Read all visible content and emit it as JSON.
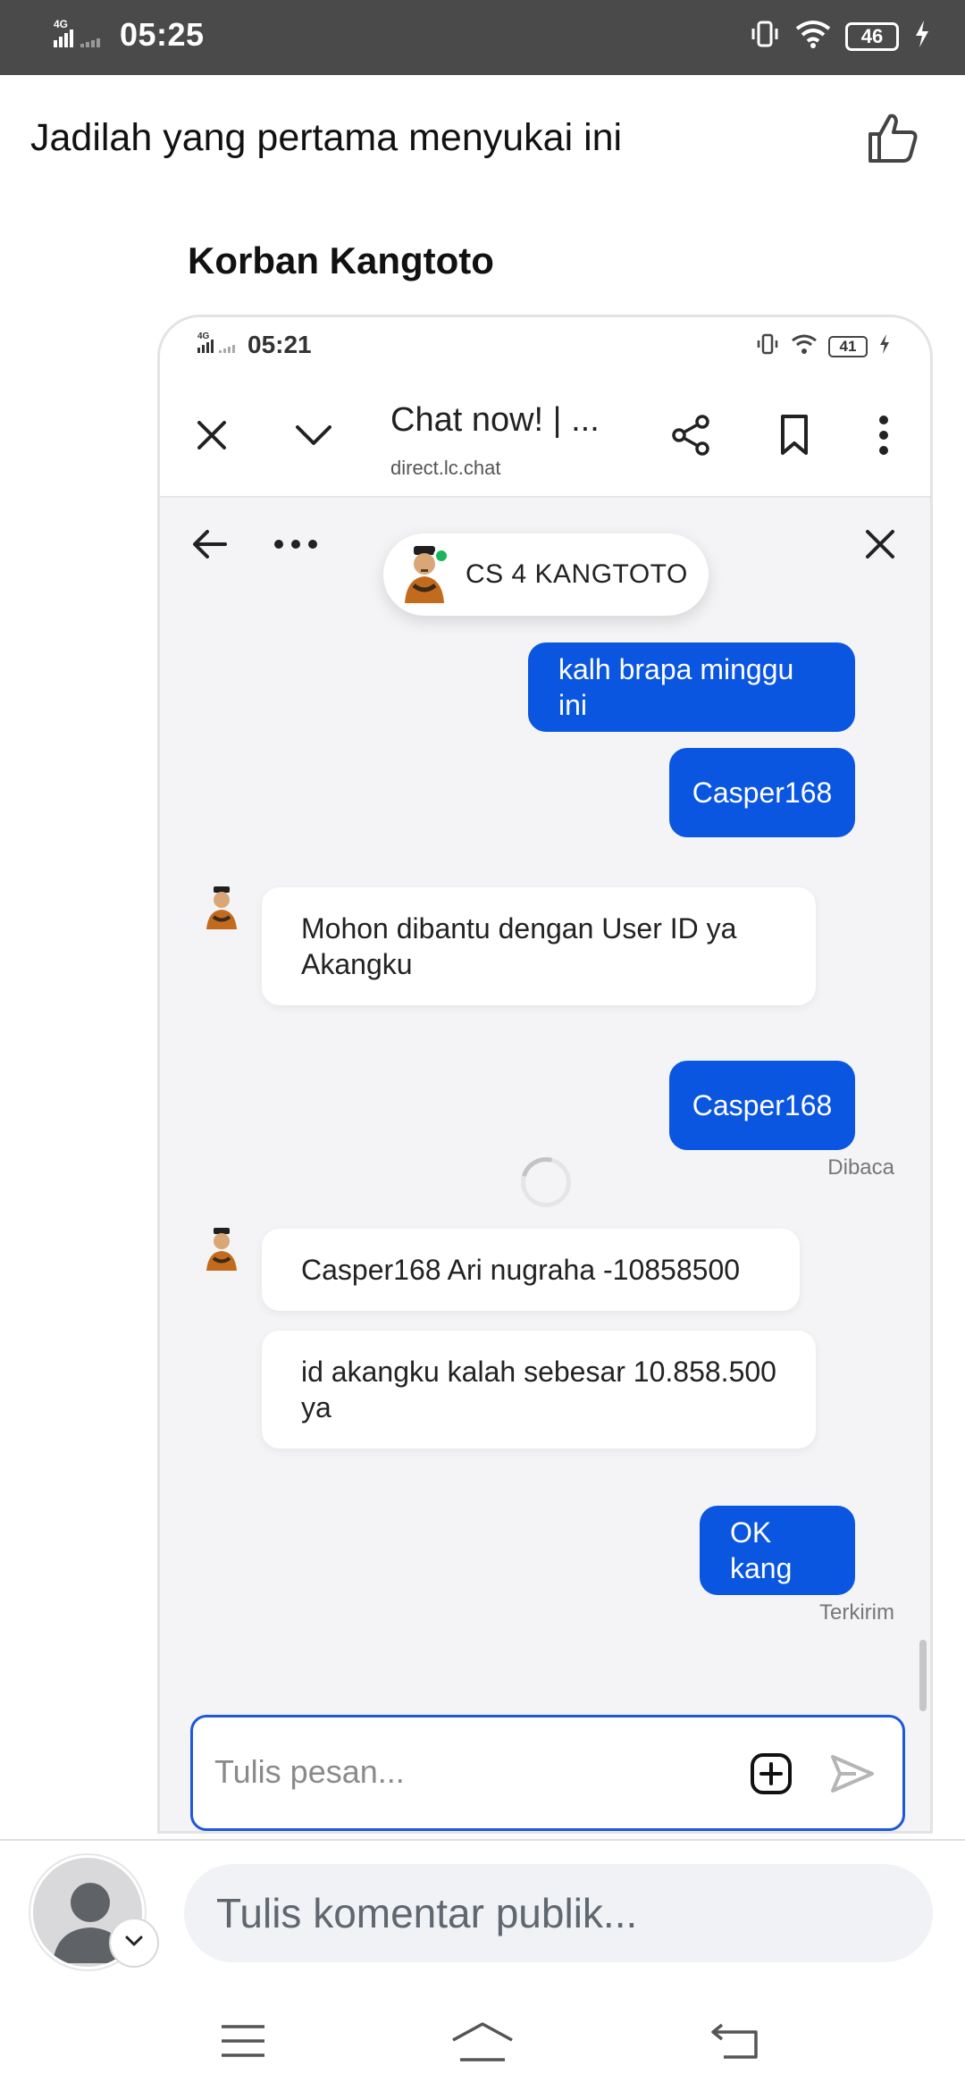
{
  "status_bar": {
    "network": "4G",
    "time": "05:25",
    "battery": "46"
  },
  "post": {
    "like_prompt": "Jadilah yang pertama menyukai ini",
    "commenter_name": "Korban Kangtoto"
  },
  "screenshot": {
    "status": {
      "network": "4G",
      "time": "05:21",
      "battery": "41"
    },
    "browser": {
      "title": "Chat now! | ...",
      "url": "direct.lc.chat"
    },
    "chat": {
      "agent_name": "CS 4 KANGTOTO",
      "messages": [
        {
          "side": "out",
          "text": "kalh brapa minggu ini"
        },
        {
          "side": "out",
          "text": "Casper168"
        },
        {
          "side": "in",
          "text": "Mohon dibantu dengan User ID ya Akangku"
        },
        {
          "side": "out",
          "text": "Casper168"
        },
        {
          "side": "in",
          "text": "Casper168 Ari nugraha -10858500"
        },
        {
          "side": "in",
          "text": "id akangku kalah sebesar 10.858.500 ya"
        },
        {
          "side": "out",
          "text": "OK kang"
        }
      ],
      "receipts": {
        "read": "Dibaca",
        "sent": "Terkirim"
      },
      "input_placeholder": "Tulis pesan..."
    }
  },
  "comment_bar": {
    "placeholder": "Tulis komentar publik..."
  },
  "colors": {
    "outgoing_bubble": "#0a56e0",
    "status_bar": "#4a4a4a",
    "online": "#1bb55c"
  },
  "icons": [
    "signal-icon",
    "vibrate-icon",
    "wifi-icon",
    "battery-icon",
    "charging-icon",
    "like-icon",
    "close-icon",
    "chevron-down-icon",
    "share-icon",
    "bookmark-icon",
    "more-vert-icon",
    "back-arrow-icon",
    "more-horiz-icon",
    "attach-icon",
    "send-icon",
    "menu-icon",
    "home-icon",
    "back-icon"
  ]
}
